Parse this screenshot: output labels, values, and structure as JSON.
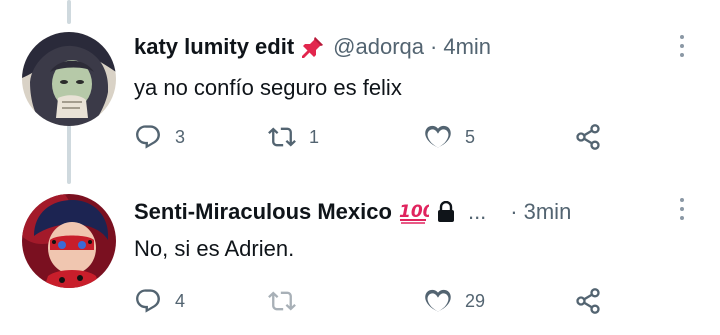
{
  "tweets": [
    {
      "author_name": "katy lumity edit",
      "badge_emoji": "📌",
      "handle": "@adorqa",
      "separator": "·",
      "time": "4min",
      "text": "ya no confío seguro es felix",
      "replies": "3",
      "retweets": "1",
      "likes": "5"
    },
    {
      "author_name": "Senti-Miraculous Mexico",
      "badge_emoji": "💯",
      "ellipsis": "...",
      "separator": "·",
      "time": "3min",
      "text": "No, si es Adrien.",
      "replies": "4",
      "retweets": "",
      "likes": "29"
    }
  ],
  "icons": {
    "reply": "reply-icon",
    "retweet": "retweet-icon",
    "like": "heart-icon",
    "share": "share-icon",
    "more": "more-options-icon",
    "lock": "lock-icon"
  },
  "colors": {
    "text": "#0f1419",
    "muted": "#536471",
    "thread_line": "#cfd9de",
    "pin_red": "#e2264d"
  }
}
